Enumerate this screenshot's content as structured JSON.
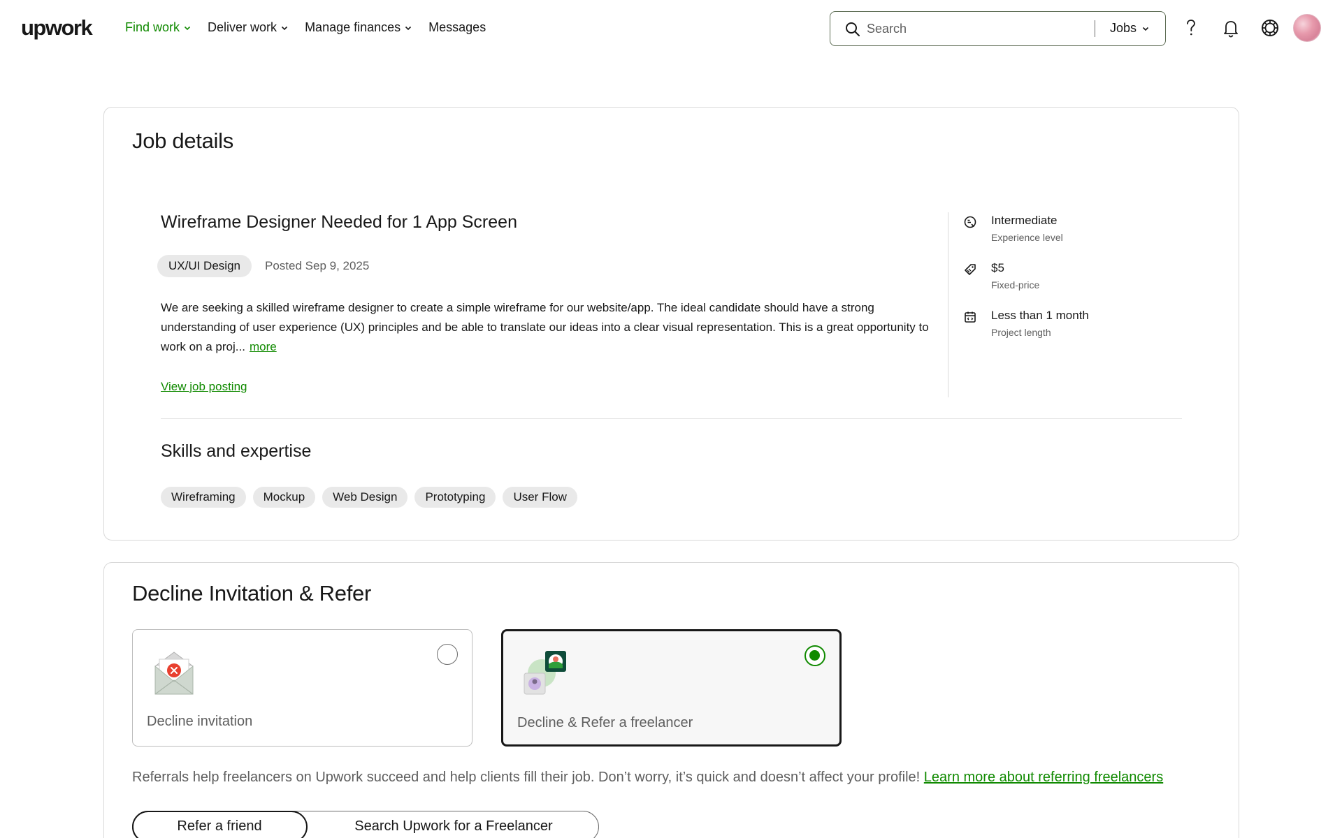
{
  "header": {
    "logo": "upwork",
    "nav": [
      {
        "label": "Find work",
        "has_menu": true,
        "active": true
      },
      {
        "label": "Deliver work",
        "has_menu": true
      },
      {
        "label": "Manage finances",
        "has_menu": true
      },
      {
        "label": "Messages",
        "has_menu": false
      }
    ],
    "search": {
      "placeholder": "Search",
      "value": "",
      "scope": "Jobs"
    },
    "icons": [
      "search-icon",
      "chevron-down-icon",
      "help-icon",
      "bell-icon",
      "apps-icon",
      "avatar"
    ],
    "accent_color": "#108a00"
  },
  "job_details": {
    "title": "Job details",
    "job_title": "Wireframe Designer Needed for 1 App Screen",
    "category": "UX/UI Design",
    "posted": "Posted Sep 9, 2025",
    "description": "We are seeking a skilled wireframe designer to create a simple wireframe for our website/app. The ideal candidate should have a strong understanding of user experience (UX) principles and be able to translate our ideas into a clear visual representation. This is a great opportunity to work on a proj...",
    "more_label": "more",
    "view_link": "View job posting",
    "meta": [
      {
        "icon": "experience-level-icon",
        "value": "Intermediate",
        "label": "Experience level"
      },
      {
        "icon": "price-tag-icon",
        "value": "$5",
        "label": "Fixed-price"
      },
      {
        "icon": "calendar-icon",
        "value": "Less than 1 month",
        "label": "Project length"
      }
    ],
    "skills_title": "Skills and expertise",
    "skills": [
      "Wireframing",
      "Mockup",
      "Web Design",
      "Prototyping",
      "User Flow"
    ]
  },
  "decline": {
    "title": "Decline Invitation & Refer",
    "options": [
      {
        "label": "Decline invitation",
        "selected": false,
        "icon": "decline-envelope-icon"
      },
      {
        "label": "Decline & Refer a freelancer",
        "selected": true,
        "icon": "refer-freelancer-icon"
      }
    ],
    "referral_text": "Referrals help freelancers on Upwork succeed and help clients fill their job. Don’t worry, it’s quick and doesn’t affect your profile!",
    "referral_link": "Learn more about referring freelancers",
    "tabs": [
      {
        "label": "Refer a friend",
        "active": true
      },
      {
        "label": "Search Upwork for a Freelancer",
        "active": false
      }
    ]
  }
}
